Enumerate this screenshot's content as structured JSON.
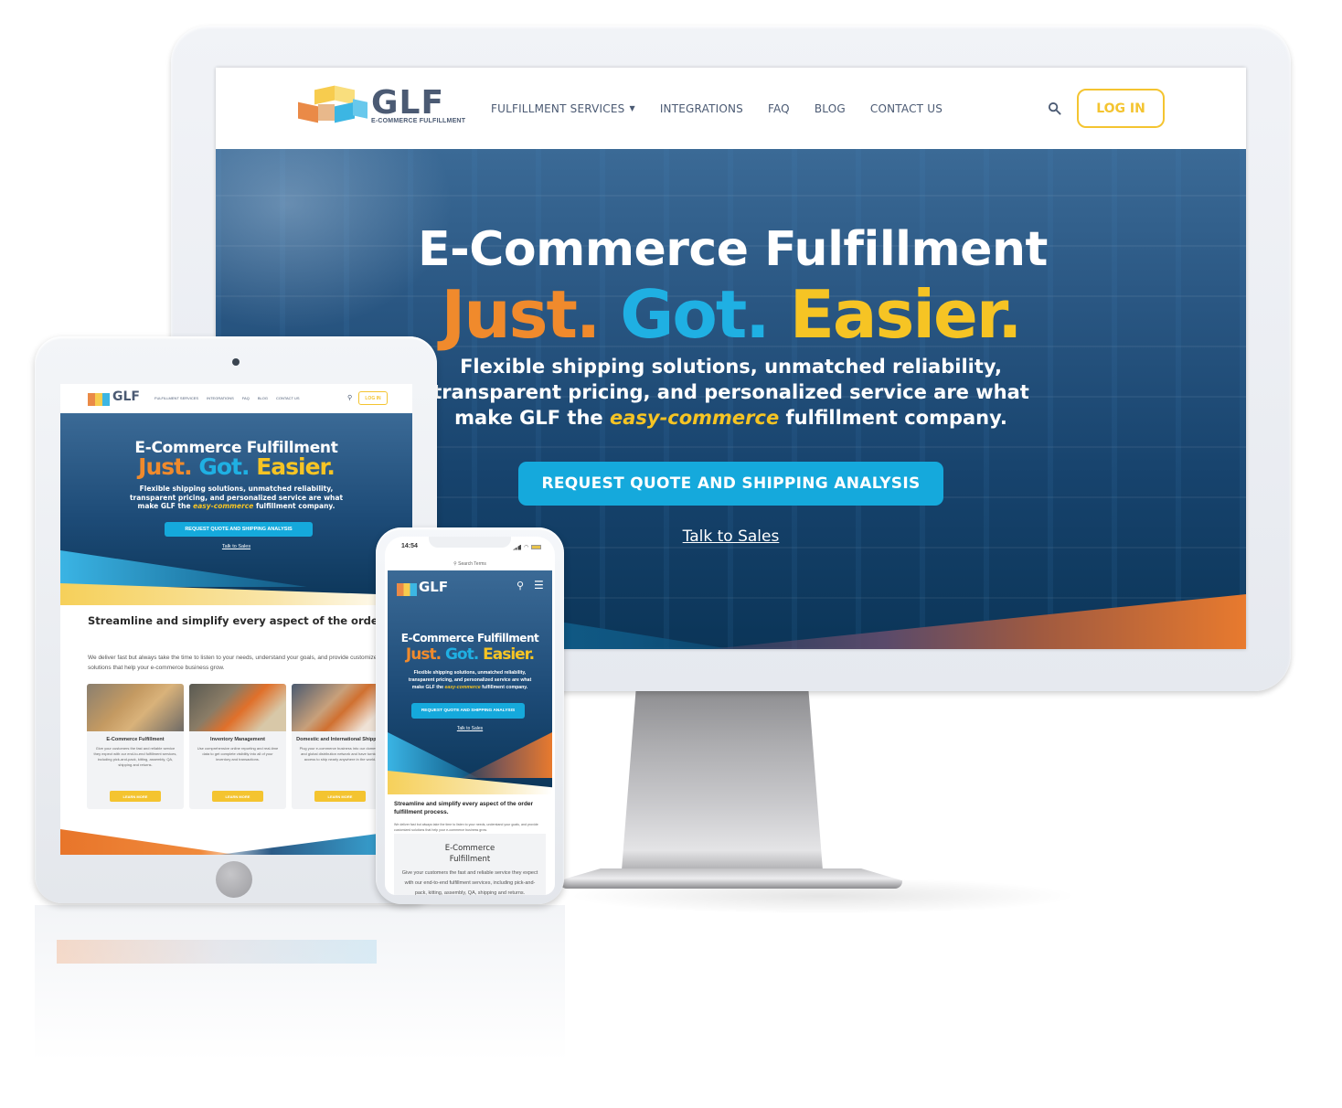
{
  "brand": {
    "name": "GLF",
    "subtitle": "E-COMMERCE FULFILLMENT",
    "colors": {
      "navy": "#0b3558",
      "orange": "#f08a2c",
      "blue": "#1fb0e3",
      "yellow": "#f6c424",
      "nav_text": "#4b5a73"
    }
  },
  "nav": {
    "items": [
      {
        "label": "FULFILLMENT SERVICES",
        "has_dropdown": true
      },
      {
        "label": "INTEGRATIONS"
      },
      {
        "label": "FAQ"
      },
      {
        "label": "BLOG"
      },
      {
        "label": "CONTACT US"
      }
    ],
    "dropdown_icon": "caret-down-icon",
    "search_icon": "search-icon",
    "login_label": "LOG IN"
  },
  "hero": {
    "title": "E-Commerce Fulfillment",
    "tagline": [
      "Just.",
      "Got.",
      "Easier."
    ],
    "desc_line1": "Flexible shipping solutions, unmatched reliability,",
    "desc_line2": "transparent pricing, and personalized service are what",
    "desc_line3_before": "make GLF the ",
    "desc_highlight": "easy-commerce",
    "desc_line3_after": " fulfillment company.",
    "cta_label": "REQUEST QUOTE AND SHIPPING ANALYSIS",
    "talk_label": "Talk to Sales"
  },
  "section": {
    "title": "Streamline and simplify every aspect of the order fulfillment process.",
    "description": "We deliver fast but always take the time to listen to your needs, understand your goals, and provide customized solutions that help your e-commerce business grow."
  },
  "cards": [
    {
      "title": "E-Commerce Fulfillment",
      "text": "Give your customers the fast and reliable service they expect with our end-to-end fulfillment services, including pick-and-pack, kitting, assembly, QA, shipping and returns.",
      "button": "LEARN MORE"
    },
    {
      "title": "Inventory Management",
      "text": "Use comprehensive online reporting and real-time data to get complete visibility into all of your inventory and transactions.",
      "button": "LEARN MORE"
    },
    {
      "title": "Domestic and International Shipping",
      "text": "Plug your e-commerce business into our domestic and global distribution network and have turnkey access to ship nearly anywhere in the world.",
      "button": "LEARN MORE"
    }
  ],
  "phone": {
    "time": "14:54",
    "search_placeholder": "Search Terms",
    "menu_icon": "hamburger-menu-icon"
  }
}
